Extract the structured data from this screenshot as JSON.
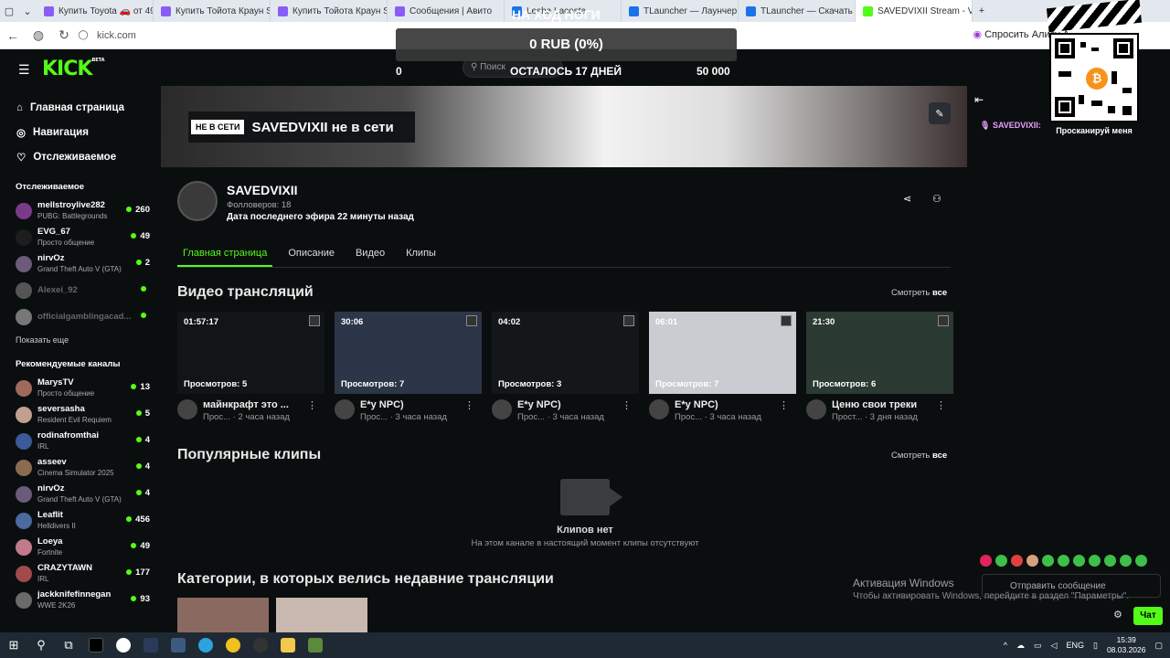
{
  "browser": {
    "tabs": [
      {
        "label": "Купить Toyota 🚗 от 49",
        "color": "#8a5cf6",
        "active": false
      },
      {
        "label": "Купить Тойота Краун S1",
        "color": "#8a5cf6",
        "active": false
      },
      {
        "label": "Купить Тойота Краун S1",
        "color": "#8a5cf6",
        "active": false
      },
      {
        "label": "Сообщения | Авито",
        "color": "#8a5cf6",
        "active": false
      },
      {
        "label": "Lesha Lacosta",
        "color": "#1a73e8",
        "active": false
      },
      {
        "label": "TLauncher — Лаунчер M",
        "color": "#1a73e8",
        "active": false
      },
      {
        "label": "TLauncher — Скачать ла",
        "color": "#1a73e8",
        "active": false
      },
      {
        "label": "SAVEDVIXII Stream - V",
        "color": "#53fc18",
        "active": true
      }
    ],
    "url": "kick.com",
    "alisa": "Спросить Алису А"
  },
  "kick": {
    "logo": "KICK",
    "logo_badge": "BETA",
    "search_placeholder": "Поиск"
  },
  "sidebar": {
    "nav": [
      {
        "icon": "home-icon",
        "glyph": "⌂",
        "label": "Главная страница"
      },
      {
        "icon": "compass-icon",
        "glyph": "◎",
        "label": "Навигация"
      },
      {
        "icon": "heart-icon",
        "glyph": "♡",
        "label": "Отслеживаемое"
      }
    ],
    "following_title": "Отслеживаемое",
    "following": [
      {
        "name": "mellstroylive282",
        "game": "PUBG: Battlegrounds",
        "viewers": "260",
        "offline": false
      },
      {
        "name": "EVG_67",
        "game": "Просто общение",
        "viewers": "49",
        "offline": false
      },
      {
        "name": "nirvOz",
        "game": "Grand Theft Auto V (GTA)",
        "viewers": "2",
        "offline": false
      },
      {
        "name": "Alexei_92",
        "game": "",
        "viewers": "",
        "offline": true
      },
      {
        "name": "officialgamblingacad...",
        "game": "",
        "viewers": "",
        "offline": true
      }
    ],
    "show_more": "Показать еще",
    "recommended_title": "Рекомендуемые каналы",
    "recommended": [
      {
        "name": "MarysTV",
        "game": "Просто общение",
        "viewers": "13"
      },
      {
        "name": "seversasha",
        "game": "Resident Evil Requiem",
        "viewers": "5"
      },
      {
        "name": "rodinafromthai",
        "game": "IRL",
        "viewers": "4"
      },
      {
        "name": "asseev",
        "game": "Cinema Simulator 2025",
        "viewers": "4"
      },
      {
        "name": "nirvOz",
        "game": "Grand Theft Auto V (GTA)",
        "viewers": "4"
      },
      {
        "name": "Leaflit",
        "game": "Helldivers II",
        "viewers": "456"
      },
      {
        "name": "Loeya",
        "game": "Fortnite",
        "viewers": "49"
      },
      {
        "name": "CRAZYTAWN",
        "game": "IRL",
        "viewers": "177"
      },
      {
        "name": "jackknifefinnegan",
        "game": "WWE 2K26",
        "viewers": "93"
      }
    ]
  },
  "banner": {
    "badge": "НЕ В СЕТИ",
    "text": "SAVEDVIXII не в сети"
  },
  "channel": {
    "name": "SAVEDVIXII",
    "followers": "Фолловеров: 18",
    "last_stream": "Дата последнего эфира 22 минуты назад",
    "tabs": [
      "Главная страница",
      "Описание",
      "Видео",
      "Клипы"
    ]
  },
  "videos_section": {
    "title": "Видео трансляций",
    "see_all_prefix": "Смотреть",
    "see_all_bold": "все",
    "items": [
      {
        "duration": "01:57:17",
        "views": "Просмотров: 5",
        "title": "майнкрафт это ...",
        "sub": "Прос... · 2 часа назад",
        "thumb": "#121517"
      },
      {
        "duration": "30:06",
        "views": "Просмотров: 7",
        "title": "E*y NPC)",
        "sub": "Прос... · 3 часа назад",
        "thumb": "#2d3548"
      },
      {
        "duration": "04:02",
        "views": "Просмотров: 3",
        "title": "E*y NPC)",
        "sub": "Прос... · 3 часа назад",
        "thumb": "#141719"
      },
      {
        "duration": "06:01",
        "views": "Просмотров: 7",
        "title": "E*y NPC)",
        "sub": "Прос... · 3 часа назад",
        "thumb": "#c9cdd2"
      },
      {
        "duration": "21:30",
        "views": "Просмотров: 6",
        "title": "Ценю свои треки",
        "sub": "Прост... · 3 дня назад",
        "thumb": "#2b3a33"
      }
    ]
  },
  "clips_section": {
    "title": "Популярные клипы",
    "see_all_prefix": "Смотреть",
    "see_all_bold": "все",
    "empty_title": "Клипов нет",
    "empty_desc": "На этом канале в настоящий момент клипы отсутствуют"
  },
  "categories_section": {
    "title": "Категории, в которых велись недавние трансляции"
  },
  "chat": {
    "first_line": "SAVEDVIXII:",
    "placeholder": "Отправить сообщение",
    "send": "Чат"
  },
  "donation_overlay": {
    "header": "НА ХОД НОГИ",
    "amount": "0 RUB (0%)",
    "min": "0",
    "remaining": "ОСТАЛОСЬ 17 ДНЕЙ",
    "goal": "50 000"
  },
  "qr": {
    "label": "Просканируй меня",
    "coin": "₿"
  },
  "windows": {
    "activation_title": "Активация Windows",
    "activation_text": "Чтобы активировать Windows, перейдите в раздел \"Параметры\".",
    "lang": "ENG",
    "time": "15:39",
    "date": "08.03.2026"
  }
}
